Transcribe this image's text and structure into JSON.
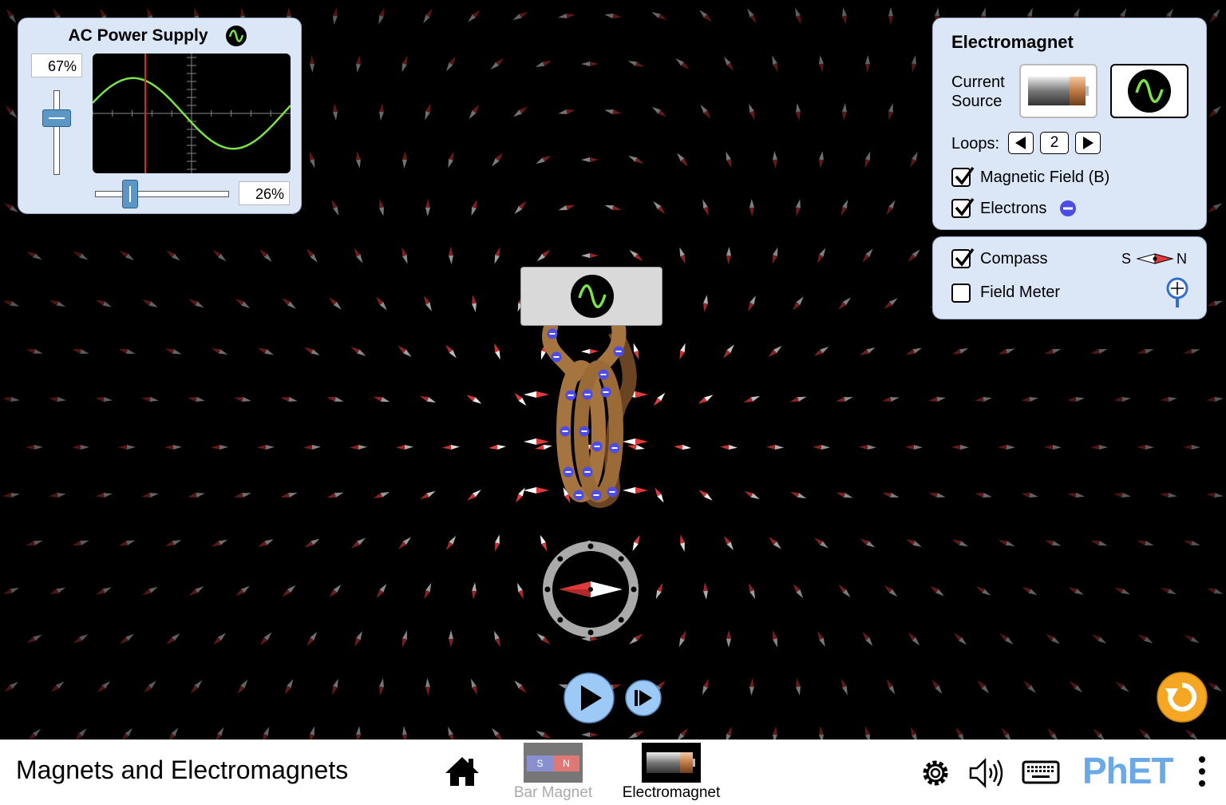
{
  "ac_panel": {
    "title": "AC Power Supply",
    "amplitude_label": "67%",
    "amplitude": 0.67,
    "frequency_label": "26%",
    "frequency": 0.26
  },
  "electromagnet_panel": {
    "title": "Electromagnet",
    "current_source_label": "Current Source",
    "current_source_selected": "ac",
    "loops_label": "Loops:",
    "loops_value": "2",
    "magnetic_field_label": "Magnetic Field (B)",
    "magnetic_field_checked": true,
    "electrons_label": "Electrons",
    "electrons_checked": true
  },
  "tools_panel": {
    "compass_label": "Compass",
    "compass_checked": true,
    "compass_s": "S",
    "compass_n": "N",
    "field_meter_label": "Field Meter",
    "field_meter_checked": false
  },
  "navbar": {
    "sim_title": "Magnets and Electromagnets",
    "screens": [
      {
        "label": "Bar Magnet",
        "selected": false,
        "icon_s": "S",
        "icon_n": "N"
      },
      {
        "label": "Electromagnet",
        "selected": true
      }
    ],
    "brand": "PhET"
  },
  "colors": {
    "panel": "#dbe6f7",
    "wave": "#7de24a",
    "needle_north": "#e03a3a",
    "electron": "#4d4de6",
    "reset": "#f5a623",
    "play": "#9cc9f5"
  },
  "icons": [
    "ac-wave-icon",
    "battery-icon",
    "play-icon",
    "step-icon",
    "reset-icon",
    "home-icon",
    "gear-icon",
    "sound-icon",
    "keyboard-icon",
    "menu-icon",
    "field-meter-probe-icon"
  ]
}
